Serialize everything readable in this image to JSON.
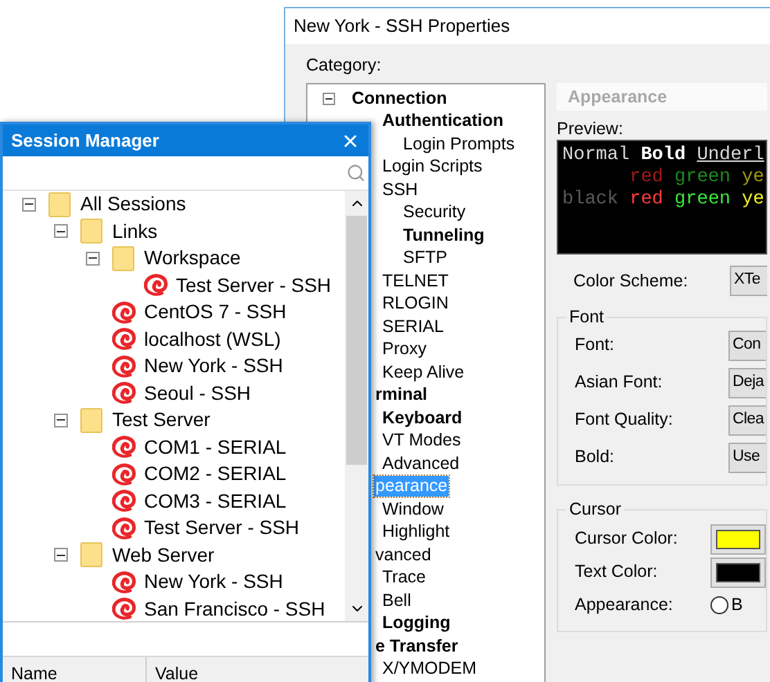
{
  "properties": {
    "title": "New York - SSH Properties",
    "category_label": "Category:",
    "category_tree": [
      {
        "label": "Connection",
        "bold": true,
        "selected": false,
        "clipped": false,
        "expanded": true,
        "children": [
          {
            "label": "Authentication",
            "bold": true,
            "selected": false,
            "children": [
              {
                "label": "Login Prompts",
                "bold": false,
                "selected": false
              }
            ]
          },
          {
            "label": "Login Scripts",
            "bold": false,
            "selected": false
          },
          {
            "label": "SSH",
            "bold": false,
            "selected": false,
            "children": [
              {
                "label": "Security",
                "bold": false,
                "selected": false
              },
              {
                "label": "Tunneling",
                "bold": true,
                "selected": false
              },
              {
                "label": "SFTP",
                "bold": false,
                "selected": false
              }
            ]
          },
          {
            "label": "TELNET",
            "bold": false,
            "selected": false
          },
          {
            "label": "RLOGIN",
            "bold": false,
            "selected": false
          },
          {
            "label": "SERIAL",
            "bold": false,
            "selected": false
          },
          {
            "label": "Proxy",
            "bold": false,
            "selected": false
          },
          {
            "label": "Keep Alive",
            "bold": false,
            "selected": false
          }
        ]
      },
      {
        "label": "rminal",
        "bold": true,
        "selected": false,
        "clipped": true,
        "children": [
          {
            "label": "Keyboard",
            "bold": true,
            "selected": false
          },
          {
            "label": "VT Modes",
            "bold": false,
            "selected": false
          },
          {
            "label": "Advanced",
            "bold": false,
            "selected": false
          }
        ]
      },
      {
        "label": "pearance",
        "bold": false,
        "selected": true,
        "clipped": true,
        "children": [
          {
            "label": "Window",
            "bold": false,
            "selected": false
          },
          {
            "label": "Highlight",
            "bold": false,
            "selected": false
          }
        ]
      },
      {
        "label": "vanced",
        "bold": false,
        "selected": false,
        "clipped": true,
        "children": [
          {
            "label": "Trace",
            "bold": false,
            "selected": false
          },
          {
            "label": "Bell",
            "bold": false,
            "selected": false
          },
          {
            "label": "Logging",
            "bold": true,
            "selected": false
          }
        ]
      },
      {
        "label": "e Transfer",
        "bold": true,
        "selected": false,
        "clipped": true,
        "children": [
          {
            "label": "X/YMODEM",
            "bold": false,
            "selected": false
          }
        ]
      }
    ],
    "panel": {
      "header": "Appearance",
      "preview_label": "Preview:",
      "preview_lines": [
        {
          "leading_gap": false,
          "segments": [
            {
              "text": "Normal",
              "kind": "plain",
              "color": "#d8d8d8"
            },
            {
              "text": "Bold",
              "kind": "strong",
              "color": "#ffffff"
            },
            {
              "text": "Underl",
              "kind": "underlined",
              "color": "#d8d8d8"
            }
          ]
        },
        {
          "leading_gap": true,
          "segments": [
            {
              "text": "red",
              "kind": "plain",
              "color": "#a01818"
            },
            {
              "text": "green",
              "kind": "plain",
              "color": "#1f8a1f"
            },
            {
              "text": "ye",
              "kind": "plain",
              "color": "#a09a10"
            }
          ]
        },
        {
          "leading_gap": false,
          "segments": [
            {
              "text": "black",
              "kind": "plain",
              "color": "#5a5a5a"
            },
            {
              "text": "red",
              "kind": "plain",
              "color": "#ff3b3b"
            },
            {
              "text": "green",
              "kind": "plain",
              "color": "#3be83b"
            },
            {
              "text": "ye",
              "kind": "plain",
              "color": "#f0f020"
            }
          ]
        }
      ],
      "color_scheme": {
        "label": "Color Scheme:",
        "value": "XTe"
      },
      "font_group": {
        "title": "Font",
        "rows": [
          {
            "label": "Font:",
            "value": "Con"
          },
          {
            "label": "Asian Font:",
            "value": "Deja"
          },
          {
            "label": "Font Quality:",
            "value": "Clea"
          },
          {
            "label": "Bold:",
            "value": "Use"
          }
        ]
      },
      "cursor_group": {
        "title": "Cursor",
        "rows": [
          {
            "label": "Cursor Color:",
            "kind": "swatch",
            "color": "#ffff00"
          },
          {
            "label": "Text Color:",
            "kind": "swatch",
            "color": "#000000"
          },
          {
            "label": "Appearance:",
            "kind": "radio",
            "value": "B",
            "selected": false
          }
        ]
      }
    }
  },
  "session_manager": {
    "title": "Session Manager",
    "tree": [
      {
        "label": "All Sessions",
        "kind": "folder",
        "expanded": true,
        "children": [
          {
            "label": "Links",
            "kind": "folder",
            "expanded": true,
            "children": [
              {
                "label": "Workspace",
                "kind": "folder",
                "expanded": true,
                "children": [
                  {
                    "label": "Test Server - SSH",
                    "kind": "session"
                  }
                ]
              },
              {
                "label": "CentOS 7 - SSH",
                "kind": "session"
              },
              {
                "label": "localhost (WSL)",
                "kind": "session"
              },
              {
                "label": "New York - SSH",
                "kind": "session"
              },
              {
                "label": "Seoul - SSH",
                "kind": "session"
              }
            ]
          },
          {
            "label": "Test Server",
            "kind": "folder",
            "expanded": true,
            "children": [
              {
                "label": "COM1 - SERIAL",
                "kind": "session"
              },
              {
                "label": "COM2 - SERIAL",
                "kind": "session"
              },
              {
                "label": "COM3 - SERIAL",
                "kind": "session"
              },
              {
                "label": "Test Server - SSH",
                "kind": "session"
              }
            ]
          },
          {
            "label": "Web Server",
            "kind": "folder",
            "expanded": true,
            "children": [
              {
                "label": "New York - SSH",
                "kind": "session"
              },
              {
                "label": "San Francisco - SSH",
                "kind": "session"
              }
            ]
          }
        ]
      }
    ],
    "columns": [
      "Name",
      "Value"
    ]
  }
}
